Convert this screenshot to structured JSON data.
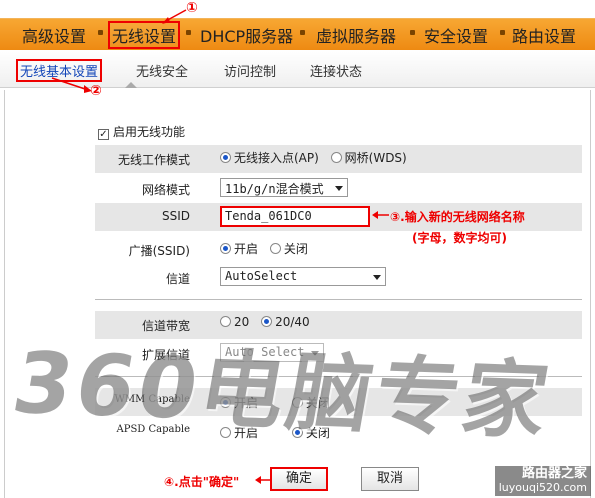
{
  "topnav": {
    "items": [
      "高级设置",
      "无线设置",
      "DHCP服务器",
      "虚拟服务器",
      "安全设置",
      "路由设置"
    ]
  },
  "subnav": {
    "items": [
      "无线基本设置",
      "无线安全",
      "访问控制",
      "连接状态"
    ]
  },
  "form": {
    "enable_wireless": "启用无线功能",
    "mode_label": "无线工作模式",
    "mode_ap": "无线接入点(AP)",
    "mode_wds": "网桥(WDS)",
    "netmode_label": "网络模式",
    "netmode_value": "11b/g/n混合模式",
    "ssid_label": "SSID",
    "ssid_value": "Tenda_061DC0",
    "broadcast_label": "广播(SSID)",
    "broadcast_on": "开启",
    "broadcast_off": "关闭",
    "channel_label": "信道",
    "channel_value": "AutoSelect",
    "bandwidth_label": "信道带宽",
    "bw_20": "20",
    "bw_2040": "20/40",
    "ext_channel_label": "扩展信道",
    "ext_channel_value": "Auto Select",
    "wmm_label": "WMM Capable",
    "wmm_on": "开启",
    "wmm_off": "关闭",
    "apsd_label": "APSD Capable",
    "apsd_on": "开启",
    "apsd_off": "关闭"
  },
  "buttons": {
    "confirm": "确定",
    "cancel": "取消"
  },
  "annotations": {
    "m1": "①",
    "m2": "②",
    "note3_line1": "③.输入新的无线网络名称",
    "note3_line2": "(字母，数字均可)",
    "note4": "④.点击\"确定\""
  },
  "watermark": {
    "text": "360电脑专家",
    "site_name": "路由器之家",
    "site_url": "luyouqi520.com"
  },
  "colors": {
    "accent": "#ee8a12",
    "annotation": "#e00000",
    "radio_selected": "#1a56c8"
  }
}
